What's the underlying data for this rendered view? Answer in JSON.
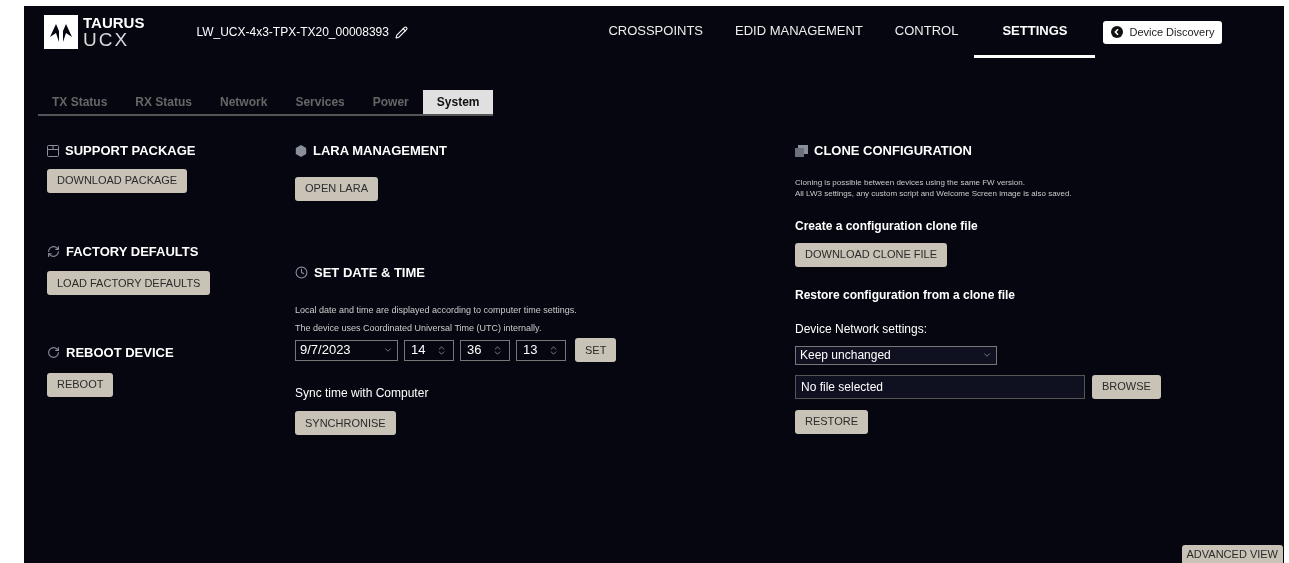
{
  "header": {
    "logo": {
      "line_1": "TAURUS",
      "line_2": "UCX"
    },
    "device_name": "LW_UCX-4x3-TPX-TX20_00008393",
    "nav": [
      {
        "label": "CROSSPOINTS",
        "selected": false
      },
      {
        "label": "EDID MANAGEMENT",
        "selected": false
      },
      {
        "label": "CONTROL",
        "selected": false
      },
      {
        "label": "SETTINGS",
        "selected": true
      }
    ],
    "discovery_button": "Device Discovery"
  },
  "subtabs": [
    {
      "label": "TX Status",
      "selected": false
    },
    {
      "label": "RX Status",
      "selected": false
    },
    {
      "label": "Network",
      "selected": false
    },
    {
      "label": "Services",
      "selected": false
    },
    {
      "label": "Power",
      "selected": false
    },
    {
      "label": "System",
      "selected": true
    }
  ],
  "support_package": {
    "title": "SUPPORT PACKAGE",
    "button": "DOWNLOAD PACKAGE"
  },
  "factory_defaults": {
    "title": "FACTORY DEFAULTS",
    "button": "LOAD FACTORY DEFAULTS"
  },
  "reboot_device": {
    "title": "REBOOT DEVICE",
    "button": "REBOOT"
  },
  "lara_management": {
    "title": "LARA MANAGEMENT",
    "button": "OPEN LARA"
  },
  "date_time": {
    "title": "SET DATE & TIME",
    "notes": [
      "Local date and time are displayed according to computer time settings.",
      "The device uses Coordinated Universal Time (UTC) internally."
    ],
    "date": "9/7/2023",
    "hour": "14",
    "minute": "36",
    "second": "13",
    "set_button": "SET",
    "sync_label": "Sync time with Computer",
    "sync_button": "SYNCHRONISE"
  },
  "clone_configuration": {
    "title": "CLONE CONFIGURATION",
    "notes": [
      "Cloning is possible between devices using the same FW version.",
      "All LW3 settings, any custom script and Welcome Screen image is also saved."
    ],
    "create_heading": "Create a configuration clone file",
    "download_button": "DOWNLOAD CLONE FILE",
    "restore_heading": "Restore configuration from a clone file",
    "network_label": "Device Network settings:",
    "network_select": "Keep unchanged",
    "file_field": "No file selected",
    "browse_button": "BROWSE",
    "restore_button": "RESTORE"
  },
  "advanced_view_button": "ADVANCED VIEW"
}
